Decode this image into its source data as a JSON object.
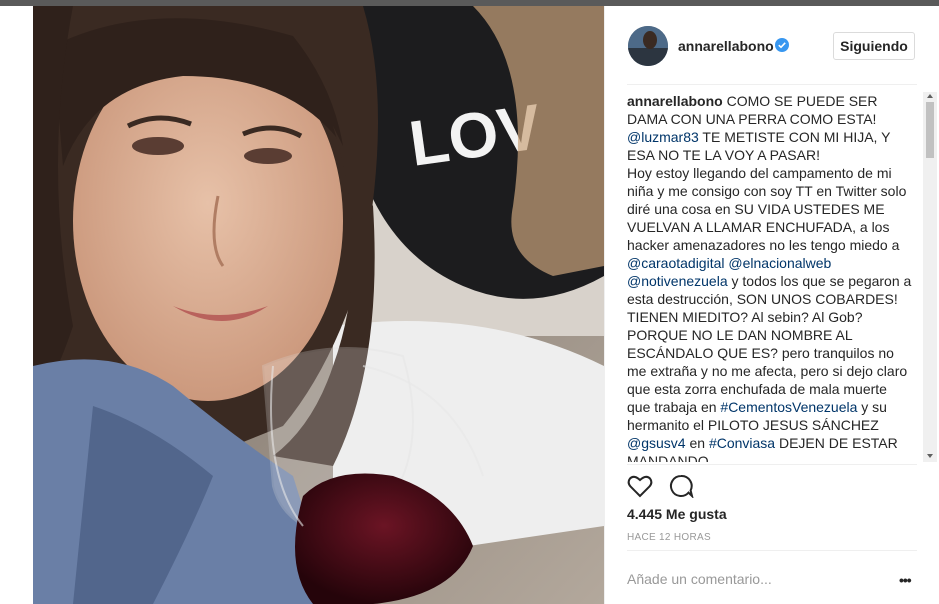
{
  "post": {
    "username": "annarellabono",
    "follow_label": "Siguiendo",
    "caption": {
      "author": "annarellabono",
      "segments": [
        {
          "type": "text",
          "value": " COMO SE PUEDE SER DAMA CON UNA PERRA COMO ESTA! "
        },
        {
          "type": "mention",
          "value": "@luzmar83"
        },
        {
          "type": "text",
          "value": " TE METISTE CON MI HIJA, Y ESA NO TE LA VOY A PASAR!"
        },
        {
          "type": "break"
        },
        {
          "type": "text",
          "value": "Hoy estoy llegando del campamento de mi niña y me consigo con soy TT en Twitter solo diré una cosa en SU VIDA USTEDES ME VUELVAN A LLAMAR ENCHUFADA, a los hacker amenazadores no les tengo miedo a "
        },
        {
          "type": "mention",
          "value": "@caraotadigital"
        },
        {
          "type": "text",
          "value": " "
        },
        {
          "type": "mention",
          "value": "@elnacionalweb"
        },
        {
          "type": "text",
          "value": " "
        },
        {
          "type": "mention",
          "value": "@notivenezuela"
        },
        {
          "type": "text",
          "value": " y todos los que se pegaron a esta destrucción, SON UNOS COBARDES! TIENEN MIEDITO? Al sebin? Al Gob? PORQUE NO LE DAN NOMBRE AL ESCÁNDALO QUE ES? pero tranquilos no me extraña y no me afecta, pero si dejo claro que esta zorra enchufada de mala muerte que trabaja en "
        },
        {
          "type": "mention",
          "value": "#CementosVenezuela"
        },
        {
          "type": "text",
          "value": " y su hermanito el PILOTO JESUS SÁNCHEZ "
        },
        {
          "type": "mention",
          "value": "@gsusv4"
        },
        {
          "type": "text",
          "value": " en "
        },
        {
          "type": "mention",
          "value": "#Conviasa"
        },
        {
          "type": "text",
          "value": " DEJEN DE ESTAR MANDANDO"
        }
      ]
    },
    "likes": "4.445 Me gusta",
    "time": "HACE 12 HORAS",
    "comment_placeholder": "Añade un comentario...",
    "more_label": "•••"
  },
  "icons": {
    "verified": "verified-badge-icon",
    "like": "heart-icon",
    "comment": "comment-icon",
    "more": "more-options-icon"
  },
  "colors": {
    "mention": "#003569",
    "verified": "#3897f0",
    "text": "#262626",
    "muted": "#999999"
  }
}
